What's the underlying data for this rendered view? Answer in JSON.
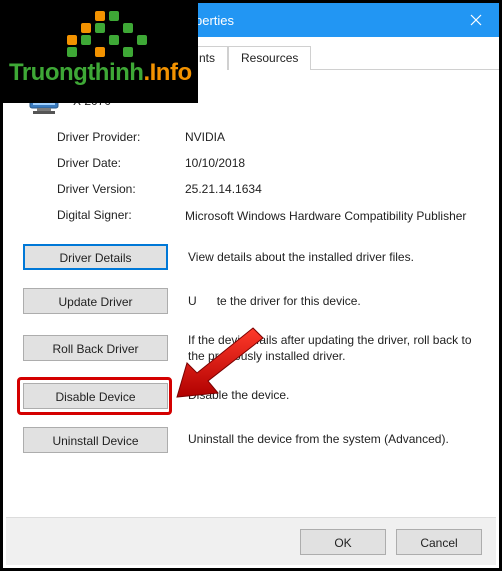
{
  "window": {
    "title_partial": "perties"
  },
  "tabs": {
    "partial1": "nts",
    "resources": "Resources"
  },
  "device": {
    "name_partial": "X 2070"
  },
  "info": {
    "provider_label": "Driver Provider:",
    "provider_value": "NVIDIA",
    "date_label": "Driver Date:",
    "date_value": "10/10/2018",
    "version_label": "Driver Version:",
    "version_value": "25.21.14.1634",
    "signer_label": "Digital Signer:",
    "signer_value": "Microsoft Windows Hardware Compatibility Publisher"
  },
  "actions": {
    "details": {
      "label": "Driver Details",
      "desc": "View details about the installed driver files."
    },
    "update": {
      "label": "Update Driver",
      "desc_partial_pre": "U",
      "desc_partial_post": "te the driver for this device."
    },
    "rollback": {
      "label": "Roll Back Driver",
      "desc": "If the device fails after updating the driver, roll back to the previously installed driver."
    },
    "disable": {
      "label": "Disable Device",
      "desc": "Disable the device."
    },
    "uninstall": {
      "label": "Uninstall Device",
      "desc": "Uninstall the device from the system (Advanced)."
    }
  },
  "footer": {
    "ok": "OK",
    "cancel": "Cancel"
  },
  "watermark": {
    "text1": "Truongthinh",
    "dot": ".",
    "text2": "Info"
  }
}
